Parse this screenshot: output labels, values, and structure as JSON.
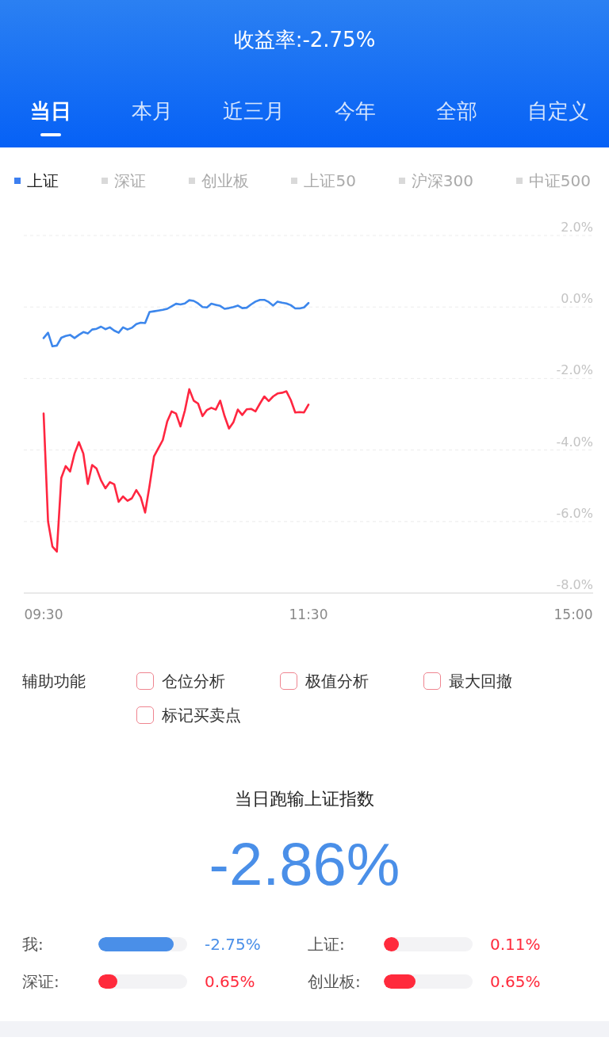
{
  "header": {
    "title": "收益率:-2.75%"
  },
  "tabs": [
    {
      "label": "当日",
      "selected": true
    },
    {
      "label": "本月",
      "selected": false
    },
    {
      "label": "近三月",
      "selected": false
    },
    {
      "label": "今年",
      "selected": false
    },
    {
      "label": "全部",
      "selected": false
    },
    {
      "label": "自定义",
      "selected": false
    }
  ],
  "index_selector": [
    {
      "label": "上证",
      "selected": true
    },
    {
      "label": "深证",
      "selected": false
    },
    {
      "label": "创业板",
      "selected": false
    },
    {
      "label": "上证50",
      "selected": false
    },
    {
      "label": "沪深300",
      "selected": false
    },
    {
      "label": "中证500",
      "selected": false
    }
  ],
  "chart": {
    "chart_data": {
      "type": "line",
      "categories": [
        "09:30",
        null,
        null,
        null,
        null,
        null,
        null,
        null,
        null,
        null,
        null,
        null,
        null,
        null,
        null,
        null,
        null,
        null,
        null,
        null,
        null,
        null,
        null,
        null,
        null,
        null,
        null,
        null,
        null,
        null,
        null,
        null,
        null,
        null,
        null,
        null,
        null,
        null,
        null,
        null,
        null,
        null,
        null,
        null,
        null,
        null,
        null,
        null,
        null,
        null,
        null,
        null,
        null,
        null,
        null,
        null,
        null,
        null,
        null,
        null,
        "11:30",
        null,
        null,
        null,
        null,
        null,
        null,
        null,
        null,
        null,
        null,
        null,
        null,
        null,
        null,
        null,
        null,
        null,
        null,
        null,
        null,
        null,
        null,
        null,
        null,
        null,
        null,
        null,
        null,
        null,
        null,
        null,
        null,
        null,
        null,
        null,
        null,
        null,
        null,
        null,
        null,
        null,
        null,
        null,
        null,
        null,
        null,
        null,
        null,
        null,
        null,
        null,
        null,
        null,
        null,
        null,
        null,
        null,
        null,
        null,
        "15:00"
      ],
      "series": [
        {
          "color": "#3d87ec",
          "values": [
            -0.87,
            -0.72,
            -1.1,
            -1.08,
            -0.86,
            -0.81,
            -0.78,
            -0.87,
            -0.78,
            -0.7,
            -0.74,
            -0.63,
            -0.61,
            -0.55,
            -0.62,
            -0.57,
            -0.66,
            -0.72,
            -0.57,
            -0.63,
            -0.58,
            -0.48,
            -0.44,
            -0.45,
            -0.14,
            -0.12,
            -0.1,
            -0.08,
            -0.05,
            0.02,
            0.09,
            0.07,
            0.1,
            0.19,
            0.17,
            0.1,
            0,
            -0.01,
            0.09,
            0.06,
            0.03,
            -0.05,
            -0.03,
            0,
            0.04,
            -0.03,
            -0.02,
            0.07,
            0.15,
            0.2,
            0.2,
            0.14,
            0.04,
            0.15,
            0.12,
            0.1,
            0.05,
            -0.04,
            -0.04,
            -0.01,
            0.11,
            null,
            null,
            null,
            null,
            null,
            null,
            null,
            null,
            null,
            null,
            null,
            null,
            null,
            null,
            null,
            null,
            null,
            null,
            null,
            null,
            null,
            null,
            null,
            null,
            null,
            null,
            null,
            null,
            null,
            null,
            null,
            null,
            null,
            null,
            null,
            null,
            null,
            null,
            null,
            null,
            null,
            null,
            null,
            null,
            null,
            null,
            null,
            null,
            null,
            null,
            null,
            null,
            null,
            null,
            null,
            null,
            null,
            null,
            null,
            null
          ]
        },
        {
          "color": "#ff2640",
          "values": [
            -2.98,
            -6.0,
            -6.7,
            -6.84,
            -4.78,
            -4.45,
            -4.6,
            -4.1,
            -3.78,
            -4.1,
            -4.95,
            -4.42,
            -4.52,
            -4.85,
            -5.07,
            -4.9,
            -4.96,
            -5.45,
            -5.3,
            -5.42,
            -5.35,
            -5.12,
            -5.32,
            -5.75,
            -5.0,
            -4.18,
            -3.95,
            -3.72,
            -3.2,
            -2.92,
            -2.98,
            -3.34,
            -2.9,
            -2.3,
            -2.62,
            -2.7,
            -3.05,
            -2.88,
            -2.82,
            -2.87,
            -2.62,
            -3.05,
            -3.4,
            -3.22,
            -2.87,
            -3.02,
            -2.86,
            -2.85,
            -2.92,
            -2.7,
            -2.5,
            -2.63,
            -2.5,
            -2.42,
            -2.4,
            -2.36,
            -2.6,
            -2.95,
            -2.94,
            -2.95,
            -2.73,
            null,
            null,
            null,
            null,
            null,
            null,
            null,
            null,
            null,
            null,
            null,
            null,
            null,
            null,
            null,
            null,
            null,
            null,
            null,
            null,
            null,
            null,
            null,
            null,
            null,
            null,
            null,
            null,
            null,
            null,
            null,
            null,
            null,
            null,
            null,
            null,
            null,
            null,
            null,
            null,
            null,
            null,
            null,
            null,
            null,
            null,
            null,
            null,
            null,
            null,
            null,
            null,
            null,
            null,
            null,
            null,
            null,
            null,
            null,
            null
          ]
        }
      ],
      "ylim": [
        -8,
        2
      ],
      "yticks": [
        {
          "value": 2,
          "label": "2.0%"
        },
        {
          "value": 0,
          "label": "0.0%"
        },
        {
          "value": -2,
          "label": "-2.0%"
        },
        {
          "value": -4,
          "label": "-4.0%"
        },
        {
          "value": -6,
          "label": "-6.0%"
        },
        {
          "value": -8,
          "label": "-8.0%"
        }
      ],
      "grid": true
    }
  },
  "assist": {
    "label": "辅助功能",
    "options": [
      {
        "label": "仓位分析",
        "checked": false
      },
      {
        "label": "极值分析",
        "checked": false
      },
      {
        "label": "最大回撤",
        "checked": false
      },
      {
        "label": "标记买卖点",
        "checked": false
      }
    ]
  },
  "summary": {
    "title": "当日跑输上证指数",
    "value": "-2.86%"
  },
  "comparison": [
    {
      "label": "我:",
      "level": 0.85,
      "value": "-2.75%",
      "color": "#4a8fe8"
    },
    {
      "label": "上证:",
      "level": 0.17,
      "value": "0.11%",
      "color": "#ff2a3c"
    },
    {
      "label": "深证:",
      "level": 0.21,
      "value": "0.65%",
      "color": "#ff2a3c"
    },
    {
      "label": "创业板:",
      "level": 0.36,
      "value": "0.65%",
      "color": "#ff2a3c"
    }
  ]
}
